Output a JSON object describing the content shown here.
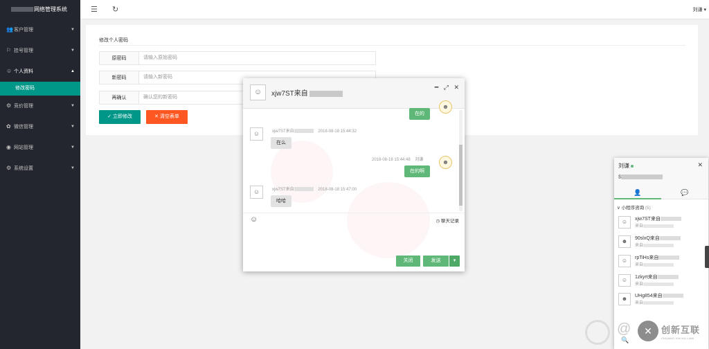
{
  "sidebar": {
    "logo_text": "网络管理系统",
    "items": [
      {
        "label": "客户管理",
        "icon": "users-icon",
        "glyph": "👥",
        "arrow": "▼"
      },
      {
        "label": "挂号管理",
        "icon": "flag-icon",
        "glyph": "⚐",
        "arrow": "▼"
      },
      {
        "label": "个人资料",
        "icon": "person-icon",
        "glyph": "☺",
        "arrow": "▲"
      },
      {
        "label": "竞价管理",
        "icon": "settings-icon",
        "glyph": "⚙",
        "arrow": "▼"
      },
      {
        "label": "微信管理",
        "icon": "wechat-icon",
        "glyph": "✿",
        "arrow": "▼"
      },
      {
        "label": "网站管理",
        "icon": "globe-icon",
        "glyph": "◉",
        "arrow": "▼"
      },
      {
        "label": "系统设置",
        "icon": "gear-icon",
        "glyph": "⚙",
        "arrow": "▼"
      }
    ],
    "submenu_active": "修改密码"
  },
  "header": {
    "user": "刘谦",
    "user_caret": "▾",
    "menu_icon": "☰",
    "refresh_icon": "↻"
  },
  "form": {
    "title": "修改个人密码",
    "rows": [
      {
        "label": "原密码",
        "placeholder": "请输入原始密码"
      },
      {
        "label": "新密码",
        "placeholder": "请输入新密码"
      },
      {
        "label": "再确认",
        "placeholder": "确认您的新密码"
      }
    ],
    "submit_label": "立即修改",
    "submit_icon": "✓",
    "clear_label": "清空表单",
    "clear_icon": "✕"
  },
  "chat": {
    "name": "xjw7ST来自",
    "avatar_glyph": "☺",
    "minimize": "━",
    "maximize": "⤢",
    "close": "✕",
    "me_avatar_glyph": "☻",
    "messages": [
      {
        "side": "right",
        "text": "在的"
      },
      {
        "side": "left",
        "sender": "xjw7ST来自",
        "time": "2018-08-18 15:44:32",
        "text": "在么"
      },
      {
        "side": "right",
        "sender": "刘谦",
        "time": "2018-08-18 15:44:48",
        "text": "在的啊"
      },
      {
        "side": "left",
        "sender": "xjw7ST来自",
        "time": "2018-08-18 15:47:00",
        "text": "哈哈"
      }
    ],
    "emoji_icon": "☺",
    "history_icon": "◷",
    "history_label": "聊天记录",
    "close_label": "关闭",
    "send_label": "发送",
    "send_caret": "▾"
  },
  "panel": {
    "name": "刘谦",
    "close": "✕",
    "sub": "$",
    "tab_friends_icon": "👤",
    "tab_chats_icon": "💬",
    "group_arrow": "∨",
    "group_label": "小程序咨询",
    "group_count": "(5)",
    "contacts": [
      {
        "name": "xjw7ST来自",
        "sub": "来自",
        "glyph": "☺"
      },
      {
        "name": "90slxQ来自",
        "sub": "来自",
        "glyph": "☻"
      },
      {
        "name": "rpTiHs来自",
        "sub": "来自",
        "glyph": "☺"
      },
      {
        "name": "1zkyrt来自",
        "sub": "来自",
        "glyph": "☺"
      },
      {
        "name": "UHg854来自",
        "sub": "来自",
        "glyph": "☻"
      }
    ],
    "search_icon": "🔍"
  },
  "watermark": {
    "at": "@",
    "logo_glyph": "✕",
    "text": "创新互联",
    "subtext": "CHUANG XIN HU LIAN"
  }
}
